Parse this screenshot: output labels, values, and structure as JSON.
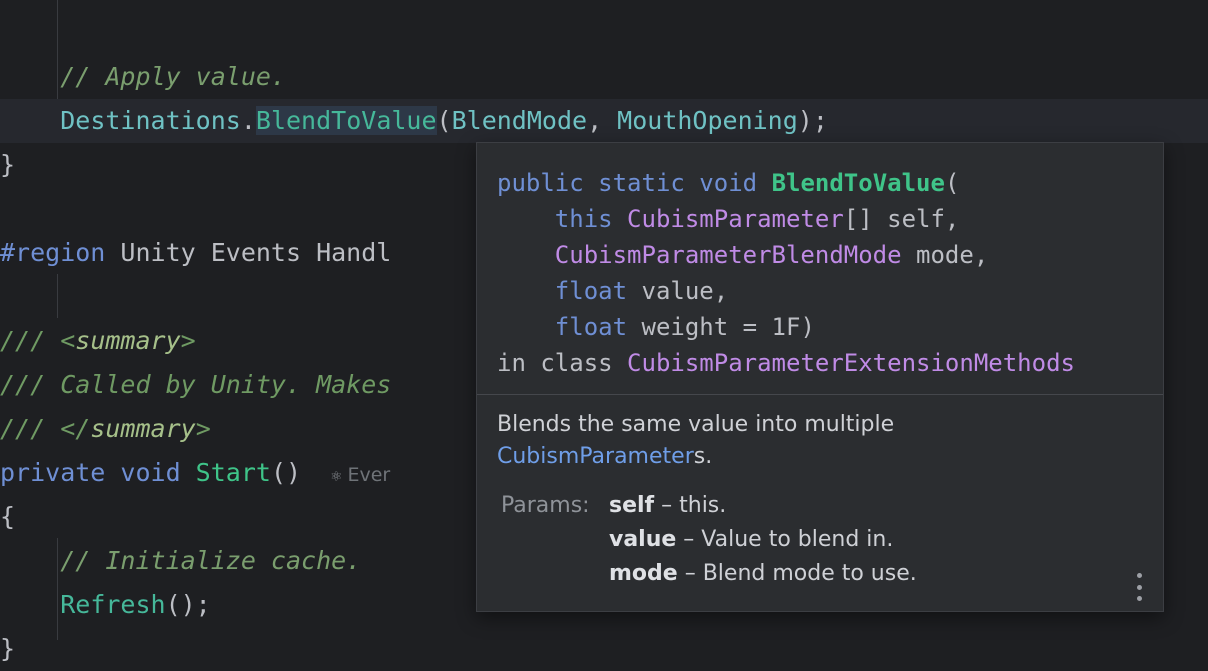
{
  "editor": {
    "lines": {
      "comment_apply": "// Apply value.",
      "dest_obj": "Destinations",
      "dot": ".",
      "dest_method": "BlendToValue",
      "dest_args_open": "(",
      "dest_arg1": "BlendMode",
      "dest_comma": ", ",
      "dest_arg2": "MouthOpening",
      "dest_close": ");",
      "close_brace": "}",
      "region_kw": "#region",
      "region_name": " Unity Events Handl",
      "doc_prefix": "/// ",
      "summary_open_lt": "<",
      "summary_tag": "summary",
      "summary_open_gt": ">",
      "doc_text": "/// Called by Unity. Makes",
      "summary_close_lt": "</",
      "summary_close_gt": ">",
      "kw_private": "private",
      "kw_void": " void ",
      "start_fn": "Start",
      "start_parens": "()",
      "hint_icon": "⚛",
      "hint_text": " Ever",
      "open_brace": "{",
      "comment_init": "// Initialize cache.",
      "refresh_fn": "Refresh",
      "refresh_tail": "();",
      "partial_brace": "}"
    }
  },
  "popup": {
    "sig": {
      "kw_public": "public",
      "kw_static": " static",
      "kw_void": " void ",
      "method": "BlendToValue",
      "paren_open": "(",
      "indent": "    ",
      "kw_this": "this",
      "type1": " CubismParameter",
      "p1_rest": "[] self,",
      "type2": "CubismParameterBlendMode",
      "p2_rest": " mode,",
      "kw_float": "float",
      "p3_rest": " value,",
      "kw_float2": "float",
      "p4_rest": " weight = 1F)",
      "in_class": "in class ",
      "class_name": "CubismParameterExtensionMethods"
    },
    "description": {
      "text1": "Blends the same value into multiple",
      "link": "CubismParameter",
      "text2": "s."
    },
    "params": {
      "label": "Params:",
      "items": [
        {
          "name": "self",
          "desc": " – this."
        },
        {
          "name": "value",
          "desc": " – Value to blend in."
        },
        {
          "name": "mode",
          "desc": " – Blend mode to use."
        }
      ]
    },
    "more_icon": "more-vertical-icon"
  }
}
